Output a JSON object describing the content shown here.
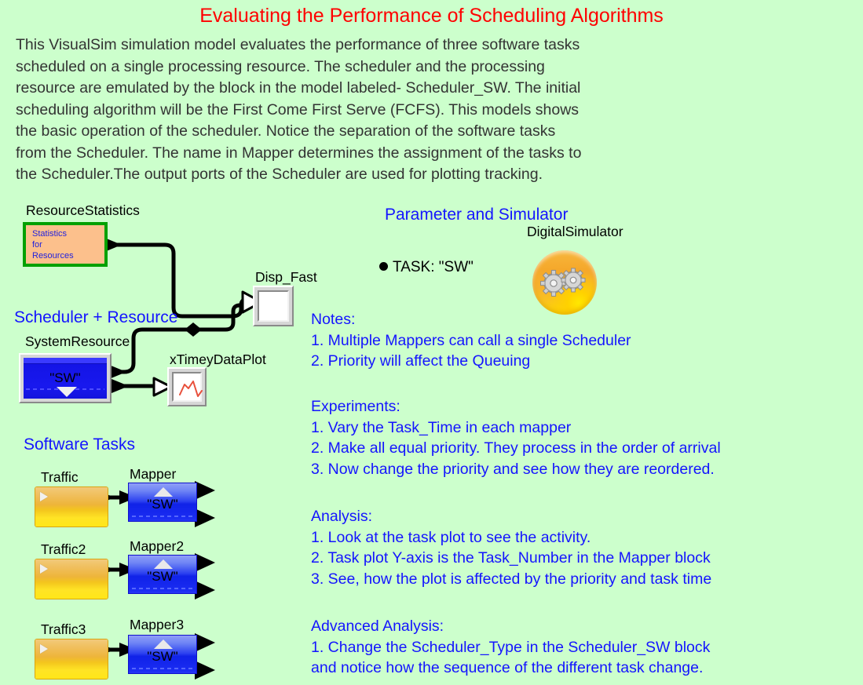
{
  "title": "Evaluating the Performance of Scheduling Algorithms",
  "intro_lines": [
    "This VisualSim simulation model evaluates the performance of three software tasks",
    "scheduled on a single processing resource.  The scheduler and the processing",
    "resource are emulated by the block in the model labeled- Scheduler_SW. The initial",
    "scheduling algorithm will be the First Come First Serve (FCFS). This models shows",
    "the basic operation of the scheduler. Notice the separation of the software tasks",
    "from the Scheduler.  The name in Mapper determines the assignment of the tasks to",
    "the Scheduler.The output ports of the Scheduler are used for plotting tracking."
  ],
  "sections": {
    "scheduler_resource": "Scheduler + Resource",
    "software_tasks": "Software Tasks",
    "parameter_simulator": "Parameter and Simulator"
  },
  "blocks": {
    "resource_statistics": {
      "label": "ResourceStatistics",
      "body": "Statistics\nfor\nResources"
    },
    "disp_fast": {
      "label": "Disp_Fast"
    },
    "system_resource": {
      "label": "SystemResource",
      "value": "\"SW\""
    },
    "xtimey_plot": {
      "label": "xTimeyDataPlot"
    },
    "digital_simulator": {
      "label": "DigitalSimulator"
    },
    "tasks": [
      {
        "traffic": "Traffic",
        "mapper": "Mapper",
        "value": "\"SW\""
      },
      {
        "traffic": "Traffic2",
        "mapper": "Mapper2",
        "value": "\"SW\""
      },
      {
        "traffic": "Traffic3",
        "mapper": "Mapper3",
        "value": "\"SW\""
      }
    ]
  },
  "parameter": {
    "task": "TASK: \"SW\""
  },
  "notes": {
    "heading": "Notes:",
    "items": [
      "1. Multiple Mappers can call a single Scheduler",
      "2. Priority will affect the Queuing"
    ]
  },
  "experiments": {
    "heading": "Experiments:",
    "items": [
      "1. Vary the Task_Time in each mapper",
      "2. Make all equal priority. They process in the order of arrival",
      "3. Now change the priority and see how they are reordered."
    ]
  },
  "analysis": {
    "heading": "Analysis:",
    "items": [
      "1. Look at the task plot to see the activity.",
      "2. Task plot Y-axis is the Task_Number in the Mapper block",
      "3. See, how the plot is affected by the priority and task time"
    ]
  },
  "advanced_analysis": {
    "heading": "Advanced Analysis:",
    "items": [
      "1. Change the Scheduler_Type in the Scheduler_SW block",
      "and notice how the sequence of the different task change."
    ]
  },
  "colors": {
    "background": "#ccffcc",
    "title": "#ff0000",
    "body_text": "#333333",
    "accent_blue": "#1414ff",
    "block_green_border": "#00a000",
    "block_peach_fill": "#fcc08c",
    "mapper_blue": "#1022e8",
    "traffic_orange": "#eeb53a",
    "plot_trace_red": "#e8503c"
  }
}
